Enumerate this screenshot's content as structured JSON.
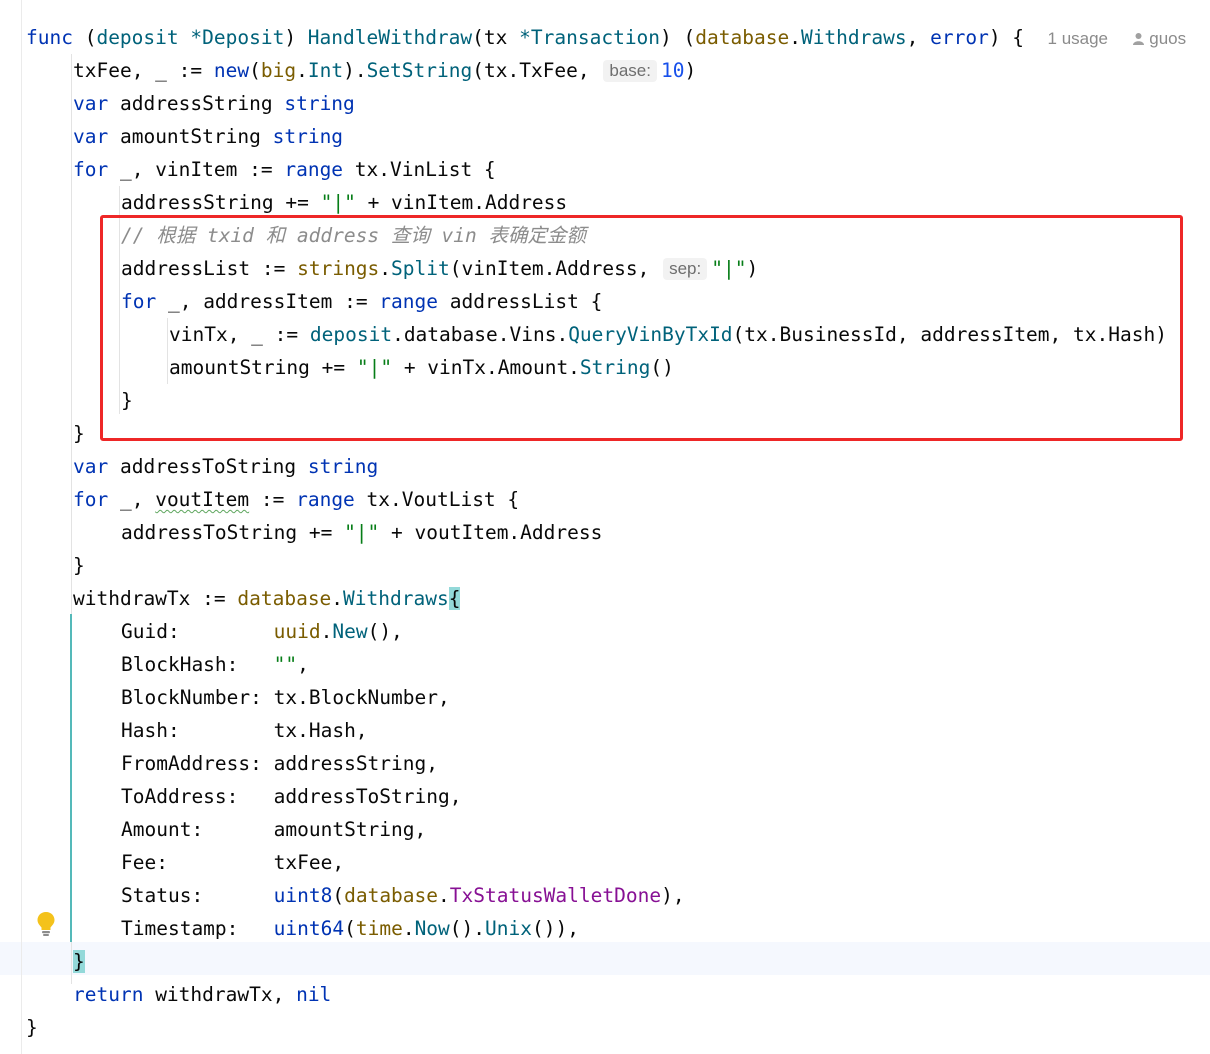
{
  "code": {
    "func_kw": "func",
    "receiver_name": "deposit",
    "receiver_type": "*Deposit",
    "func_name": "HandleWithdraw",
    "param_name": "tx",
    "param_type": "*Transaction",
    "ret_pkg": "database",
    "ret_type": "Withdraws",
    "ret_err": "error",
    "usage_text": "1 usage",
    "author_text": "guos",
    "l2": {
      "var": "txFee, _ := ",
      "fn": "new",
      "pkg": "big",
      "type": "Int",
      "method": "SetString",
      "args": "(tx.TxFee, ",
      "hint": "base:",
      "num": "10"
    },
    "l3": {
      "kw": "var",
      "name": " addressString ",
      "type": "string"
    },
    "l4": {
      "kw": "var",
      "name": " amountString ",
      "type": "string"
    },
    "l5": {
      "kw": "for",
      "pre": " _, vinItem := ",
      "range": "range",
      "post": " tx.VinList {"
    },
    "l6": {
      "pre": "addressString += ",
      "str": "\"|\"",
      "post": " + vinItem.Address"
    },
    "l7": {
      "comment": "// 根据 txid 和 address 查询 vin 表确定金额"
    },
    "l8": {
      "pre": "addressList := ",
      "pkg": "strings",
      "fn": "Split",
      "args": "(vinItem.Address, ",
      "hint": "sep:",
      "str": "\"|\"",
      "close": ")"
    },
    "l9": {
      "kw": "for",
      "pre": " _, addressItem := ",
      "range": "range",
      "post": " addressList {"
    },
    "l10": {
      "pre": "vinTx, _ := ",
      "recv": "deposit",
      "mid": ".database.Vins.",
      "fn": "QueryVinByTxId",
      "args": "(tx.BusinessId, addressItem, tx.Hash)"
    },
    "l11": {
      "pre": "amountString += ",
      "str": "\"|\"",
      "mid": " + vinTx.Amount.",
      "fn": "String",
      "post": "()"
    },
    "l12": "}",
    "l13": "}",
    "l14": {
      "kw": "var",
      "name": " addressToString ",
      "type": "string"
    },
    "l15": {
      "kw": "for",
      "pre": " _, ",
      "item": "voutItem",
      "mid": " := ",
      "range": "range",
      "post": " tx.VoutList {"
    },
    "l16": {
      "pre": "addressToString += ",
      "str": "\"|\"",
      "post": " + voutItem.Address"
    },
    "l17": "}",
    "l18": {
      "pre": "withdrawTx := ",
      "pkg": "database",
      "type": "Withdraws",
      "brace": "{"
    },
    "fields": [
      {
        "key": "Guid:",
        "pad": "        ",
        "a": "uuid",
        "b": ".",
        "c": "New",
        "d": "(),"
      },
      {
        "key": "BlockHash:",
        "pad": "   ",
        "str": "\"\"",
        "tail": ","
      },
      {
        "key": "BlockNumber:",
        "pad": " ",
        "plain": "tx.BlockNumber,"
      },
      {
        "key": "Hash:",
        "pad": "        ",
        "plain": "tx.Hash,"
      },
      {
        "key": "FromAddress:",
        "pad": " ",
        "plain": "addressString,"
      },
      {
        "key": "ToAddress:",
        "pad": "   ",
        "plain": "addressToString,"
      },
      {
        "key": "Amount:",
        "pad": "      ",
        "plain": "amountString,"
      },
      {
        "key": "Fee:",
        "pad": "         ",
        "plain": "txFee,"
      },
      {
        "key": "Status:",
        "pad": "      ",
        "t": "uint8",
        "o": "(",
        "p": "database",
        "dot": ".",
        "m": "TxStatusWalletDone",
        "e": "),"
      },
      {
        "key": "Timestamp:",
        "pad": "   ",
        "t": "uint64",
        "o": "(",
        "p": "time",
        "dot": ".",
        "f1": "Now",
        "mid": "().",
        "f2": "Unix",
        "e": "()),"
      }
    ],
    "l29": "}",
    "l30": {
      "kw": "return",
      "post": " withdrawTx, ",
      "nil": "nil"
    },
    "l31": "}"
  },
  "colors": {
    "keyword": "#0033b3",
    "string": "#067d17",
    "comment": "#8c8c8c",
    "highlight_box": "#ee2727",
    "brace_match": "#93d9d9"
  },
  "icons": {
    "intention": "lightbulb-icon",
    "author": "user-icon"
  }
}
